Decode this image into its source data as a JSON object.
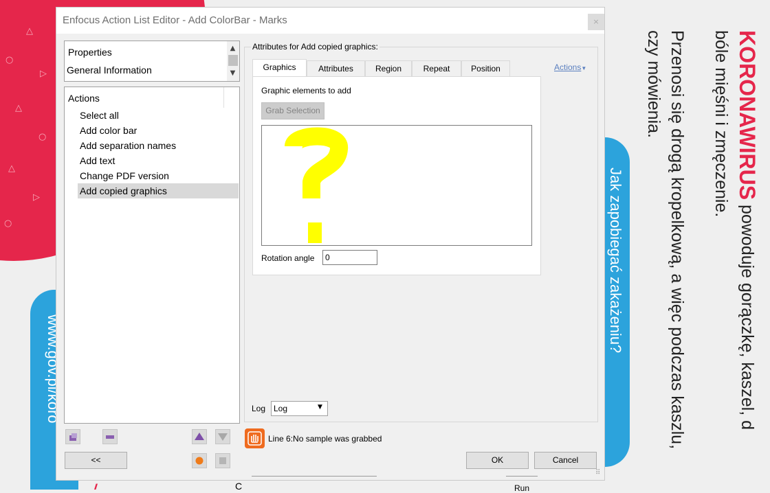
{
  "window": {
    "title": "Enfocus Action List Editor - Add  ColorBar - Marks",
    "close_icon": "×"
  },
  "left_panel": {
    "properties_list": [
      "Properties",
      "General Information"
    ],
    "actions_header": "Actions",
    "actions": [
      "Select all",
      "Add color bar",
      "Add separation names",
      "Add text",
      "Change PDF version",
      "Add copied graphics"
    ],
    "selected_action_index": 5,
    "collapse_button": "<<"
  },
  "attributes": {
    "group_label": "Attributes for Add copied graphics:",
    "tabs": [
      "Graphics",
      "Attributes",
      "Region",
      "Repeat",
      "Position"
    ],
    "active_tab": "Graphics",
    "actions_link": "Actions",
    "graphic_elements_label": "Graphic elements to add",
    "grab_selection_button": "Grab Selection",
    "preview_glyph": "?",
    "preview_color": "#ffff00",
    "rotation_label": "Rotation angle",
    "rotation_value": "0",
    "log_label": "Log",
    "log_value": "Log"
  },
  "status": {
    "message": "Line 6:No sample was grabbed",
    "icon": "stop-hand-icon",
    "icon_color": "#ef6b1f"
  },
  "footer": {
    "ok_label": "OK",
    "cancel_label": "Cancel",
    "run_partial": "Run",
    "c_partial": "C"
  },
  "poster": {
    "heading": "KORONAWIRUS",
    "line1_rest": " powoduje gorączkę, kaszel, d",
    "line2": "bóle mięśni i zmęczenie.",
    "line3": "Przenosi się drogą kropelkową, a więc podczas kaszlu,",
    "line4": "czy mówienia.",
    "blue_right_text": "Jak zapobiegać zakażeniu?",
    "blue_left_text": "www.gov.pl/koro",
    "bottom_partial": "/",
    "accent_red": "#e5264b",
    "accent_blue": "#2ca3dc"
  }
}
